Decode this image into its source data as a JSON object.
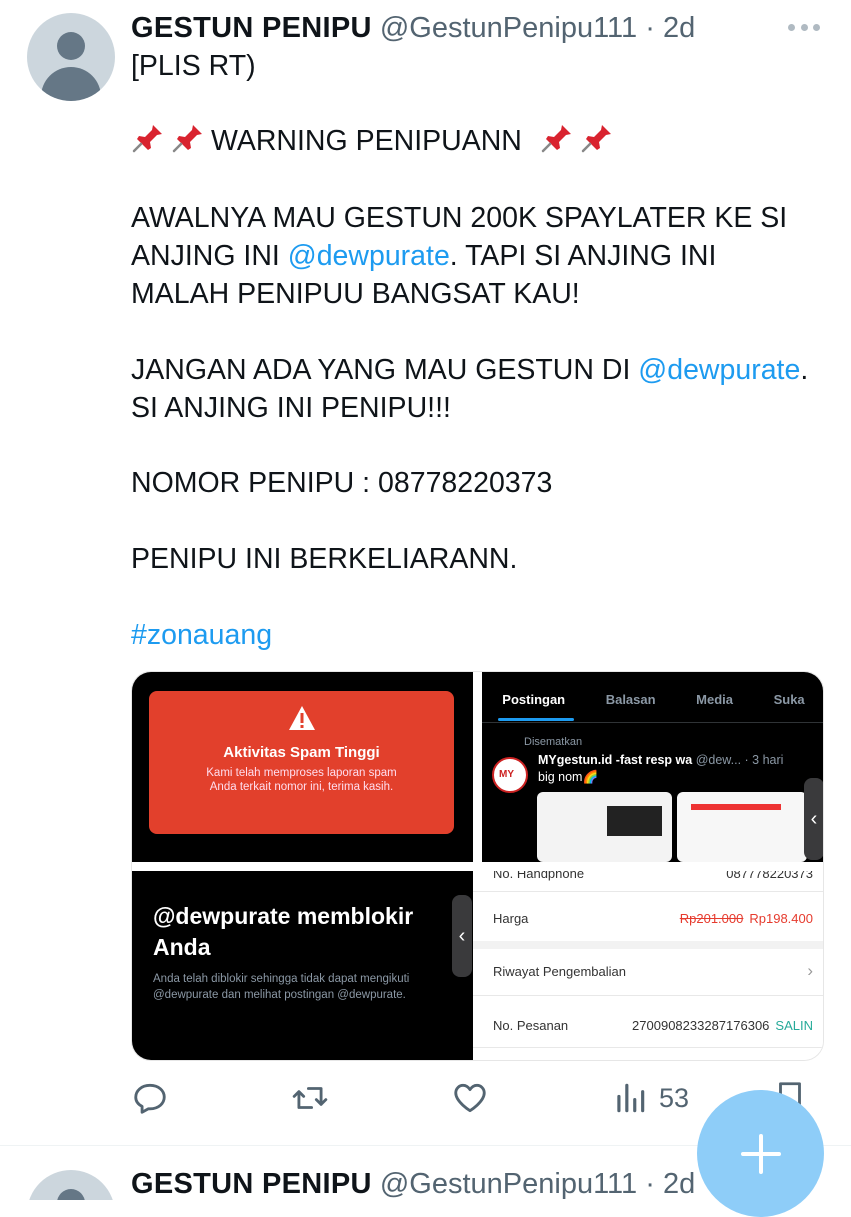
{
  "tweet": {
    "name": "GESTUN PENIPU",
    "handle": "@GestunPenipu111",
    "dot": "·",
    "time": "2d",
    "lines": {
      "l1": "[PLIS RT)",
      "warning": "WARNING PENIPUANN",
      "l3a": "AWALNYA MAU GESTUN 200K SPAYLATER KE SI",
      "l3b_pre": "ANJING INI ",
      "mention1": "@dewpurate",
      "l3b_post": ". TAPI SI ANJING INI",
      "l3c": "MALAH PENIPUU BANGSAT KAU!",
      "l4a_pre": "JANGAN ADA YANG MAU GESTUN DI ",
      "mention2": "@dewpurate",
      "l4a_post": ".",
      "l4b": "SI ANJING INI PENIPU!!!",
      "l5": "NOMOR PENIPU : 08778220373",
      "l6": "PENIPU INI BERKELIARANN.",
      "hashtag": "#zonauang"
    },
    "media": {
      "spam_title": "Aktivitas Spam Tinggi",
      "spam_text1": "Kami telah memproses laporan spam",
      "spam_text2": "Anda terkait nomor ini, terima kasih.",
      "tabs": [
        "Postingan",
        "Balasan",
        "Media",
        "Suka"
      ],
      "pinned": "Disematkan",
      "acct_name": "MYgestun.id -fast resp wa",
      "acct_meta": "@dew... · 3 hari",
      "acct_text": "big nom🌈",
      "block_title": "@dewpurate memblokir Anda",
      "block_text": "Anda telah diblokir sehingga tidak dapat mengikuti @dewpurate dan melihat postingan @dewpurate.",
      "r1_label": "No. Handphone",
      "r1_value": "087778220373",
      "r2_label": "Harga",
      "r2_old": "Rp201.000",
      "r2_new": "Rp198.400",
      "r3_label": "Riwayat Pengembalian",
      "r3_arrow": "›",
      "r4_label": "No. Pesanan",
      "r4_value": "2700908233287176306",
      "r4_action": "SALIN"
    },
    "views": "53"
  },
  "next_tweet": {
    "name": "GESTUN PENIPU",
    "handle": "@GestunPenipu111",
    "dot": "·",
    "time": "2d"
  },
  "colors": {
    "link": "#1d9bf0",
    "fab": "#8ecdf8",
    "muted": "#536471"
  },
  "icons": [
    "avatar-placeholder",
    "more-icon",
    "pushpin-icon",
    "reply-icon",
    "retweet-icon",
    "like-icon",
    "views-icon",
    "bookmark-icon",
    "compose-plus-icon"
  ]
}
